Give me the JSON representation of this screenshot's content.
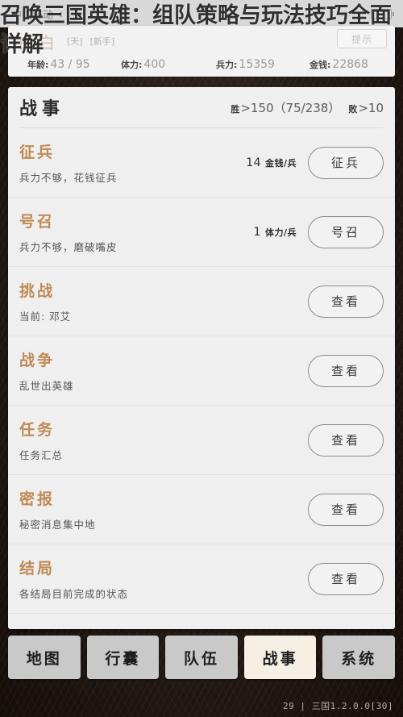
{
  "overlay": {
    "article_title": "召唤三国英雄：组队策略与玩法技巧全面详解"
  },
  "statusbar": {
    "carrier": "中国移动",
    "wifi_icon": "wifi-icon",
    "battery_icon": "battery-icon"
  },
  "player": {
    "name": "白白",
    "tags": [
      "[天]",
      "[新手]"
    ],
    "hint_button": "提示",
    "stats": [
      {
        "label": "年龄:",
        "value": "43 / 95"
      },
      {
        "label": "体力:",
        "value": "400"
      },
      {
        "label": "兵力:",
        "value": "15359"
      },
      {
        "label": "金钱:",
        "value": "22868"
      }
    ]
  },
  "card": {
    "title": "战事",
    "stats": [
      {
        "label": "胜",
        "value": ">150（75/238）"
      },
      {
        "label": "败",
        "value": ">10"
      }
    ],
    "rows": [
      {
        "title": "征兵",
        "desc": "兵力不够，花钱征兵",
        "cost_number": "14",
        "cost_unit": "金钱/兵",
        "button": "征兵"
      },
      {
        "title": "号召",
        "desc": "兵力不够，磨破嘴皮",
        "cost_number": "1",
        "cost_unit": "体力/兵",
        "button": "号召"
      },
      {
        "title": "挑战",
        "desc": "当前: 邓艾",
        "cost_number": "",
        "cost_unit": "",
        "button": "查看"
      },
      {
        "title": "战争",
        "desc": "乱世出英雄",
        "cost_number": "",
        "cost_unit": "",
        "button": "查看"
      },
      {
        "title": "任务",
        "desc": "任务汇总",
        "cost_number": "",
        "cost_unit": "",
        "button": "查看"
      },
      {
        "title": "密报",
        "desc": "秘密消息集中地",
        "cost_number": "",
        "cost_unit": "",
        "button": "查看"
      },
      {
        "title": "结局",
        "desc": "各结局目前完成的状态",
        "cost_number": "",
        "cost_unit": "",
        "button": "查看"
      }
    ]
  },
  "nav": {
    "items": [
      {
        "label": "地图",
        "active": false
      },
      {
        "label": "行囊",
        "active": false
      },
      {
        "label": "队伍",
        "active": false
      },
      {
        "label": "战事",
        "active": true
      },
      {
        "label": "系统",
        "active": false
      }
    ],
    "version": "29 | 三国1.2.0.0[30]"
  },
  "colors": {
    "row_title": "#c08a55",
    "player_name": "#d8b9a8",
    "nav_active_bg": "#f5efe4",
    "nav_bg": "#c9c9c9",
    "card_bg": "#efefef",
    "page_bg": "#241a14"
  }
}
